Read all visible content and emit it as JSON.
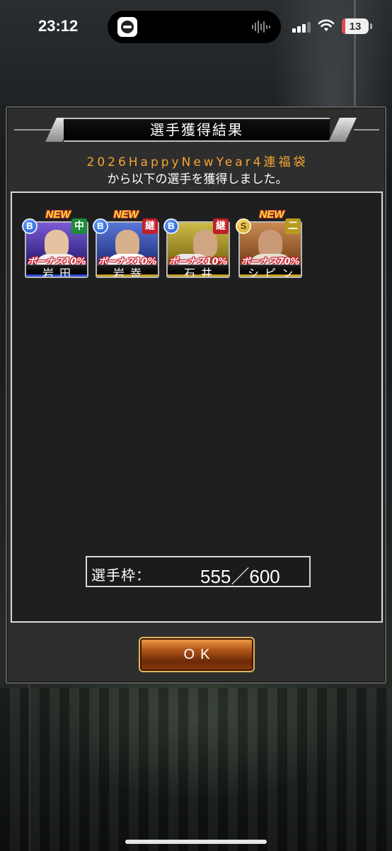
{
  "status_bar": {
    "time": "23:12",
    "battery_level": "13",
    "battery_fraction": 0.13
  },
  "dialog": {
    "title": "選手獲得結果",
    "subtitle_line1": "2026HappyNewYear4連福袋",
    "subtitle_line2": "から以下の選手を獲得しました。",
    "players": [
      {
        "name": "岩田",
        "new_label": "NEW",
        "rank": "B",
        "position": "中",
        "position_color": "#1e8a3a",
        "bonus": "ボーナス10%",
        "accent": "blue"
      },
      {
        "name": "岩嵜",
        "new_label": "NEW",
        "rank": "B",
        "position": "継",
        "position_color": "#c0202a",
        "bonus": "ボーナス10%",
        "accent": "gold"
      },
      {
        "name": "石井",
        "new_label": "",
        "rank": "B",
        "position": "継",
        "position_color": "#c0202a",
        "bonus": "ボーナス10%",
        "accent": "gold"
      },
      {
        "name": "シピン",
        "new_label": "NEW",
        "rank": "S",
        "position": "二",
        "position_color": "#b89a20",
        "bonus": "ボーナス70%",
        "accent": "gold"
      }
    ],
    "slots_label": "選手枠：",
    "slots_value": "555／600",
    "ok_label": "OK"
  },
  "colors": {
    "subtitle_accent": "#f2a531",
    "ok_button": "#b4561b"
  }
}
